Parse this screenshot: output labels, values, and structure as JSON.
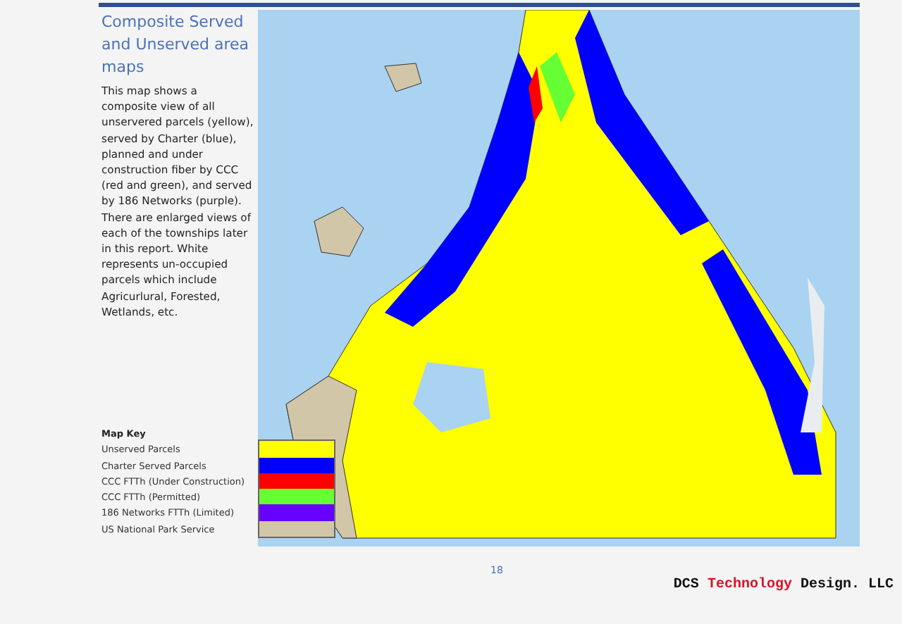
{
  "section_title": "Composite Served and Unserved area maps",
  "description": "This map shows a composite view of all unservered parcels (yellow), served by Charter (blue), planned and under construction fiber by CCC (red and green), and served by 186 Networks (purple).  There are enlarged views of each of the townships later in this report.  White represents un-occupied parcels which include Agricurlural, Forested, Wetlands, etc.",
  "map_key": {
    "title": "Map Key",
    "items": [
      {
        "label": "Unserved Parcels",
        "color": "#ffff00"
      },
      {
        "label": "Charter Served Parcels",
        "color": "#0000ff"
      },
      {
        "label": "CCC FTTh (Under Construction)",
        "color": "#ff0000"
      },
      {
        "label": "CCC FTTh (Permitted)",
        "color": "#66ff33"
      },
      {
        "label": "186 Networks FTTh (Limited)",
        "color": "#6600ff"
      },
      {
        "label": "US National Park Service",
        "color": "#d2c6a8"
      }
    ]
  },
  "page_number": "18",
  "footer_logo": {
    "prefix": "DCS",
    "highlight": "Technology",
    "suffix": "Design. LLC"
  }
}
